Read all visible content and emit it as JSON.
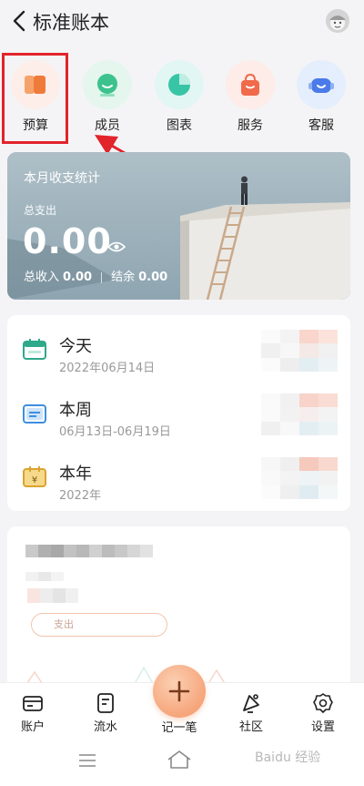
{
  "header": {
    "title": "标准账本"
  },
  "quick_actions": [
    {
      "label": "预算",
      "icon": "budget-icon",
      "bg": "#fdeee9",
      "accent": "#f08a4b"
    },
    {
      "label": "成员",
      "icon": "member-icon",
      "bg": "#e4f6ee",
      "accent": "#3cc28d"
    },
    {
      "label": "图表",
      "icon": "chart-icon",
      "bg": "#e2f6f3",
      "accent": "#38c5a6"
    },
    {
      "label": "服务",
      "icon": "service-icon",
      "bg": "#fdece8",
      "accent": "#f06a4b"
    },
    {
      "label": "客服",
      "icon": "support-icon",
      "bg": "#e5eefc",
      "accent": "#4a7be8"
    }
  ],
  "stats": {
    "title": "本月收支统计",
    "expense_label": "总支出",
    "expense_value": "0.00",
    "income_label": "总收入",
    "income_value": "0.00",
    "balance_label": "结余",
    "balance_value": "0.00"
  },
  "periods": [
    {
      "name": "今天",
      "date": "2022年06月14日",
      "icon": "calendar-today-icon"
    },
    {
      "name": "本周",
      "date": "06月13日-06月19日",
      "icon": "calendar-week-icon"
    },
    {
      "name": "本年",
      "date": "2022年",
      "icon": "calendar-year-icon"
    }
  ],
  "budget_card": {
    "pill_text": "支出"
  },
  "bottom_nav": [
    {
      "label": "账户",
      "icon": "wallet-icon"
    },
    {
      "label": "流水",
      "icon": "bill-icon"
    },
    {
      "label": "记一笔",
      "icon": "plus-icon"
    },
    {
      "label": "社区",
      "icon": "community-icon"
    },
    {
      "label": "设置",
      "icon": "gear-icon"
    }
  ],
  "watermark": "Baidu 经验",
  "colors": {
    "highlight": "#e2242b",
    "fab": "#f6a57b",
    "card_bg": "#8ea7b3"
  }
}
